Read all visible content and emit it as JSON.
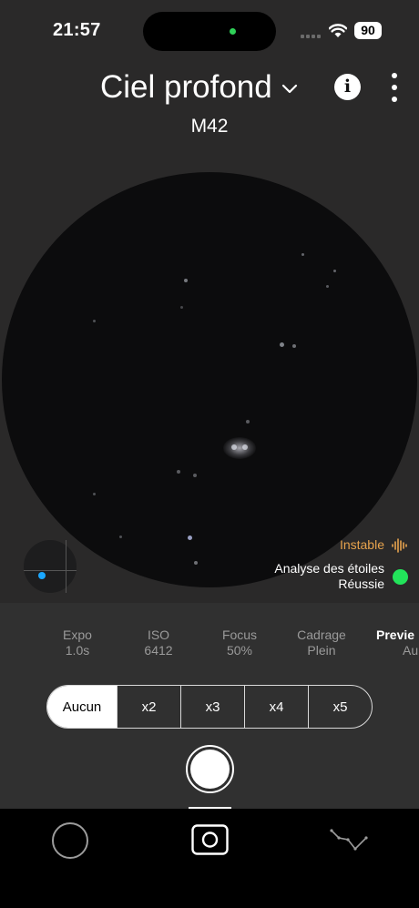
{
  "status_bar": {
    "time": "21:57",
    "battery": "90"
  },
  "header": {
    "mode_title": "Ciel profond",
    "target": "M42",
    "icons": {
      "mode_dropdown": "chevron-down-icon",
      "info": "info-icon",
      "more": "more-vertical-icon"
    },
    "info_glyph": "i"
  },
  "viewer": {
    "stability_label": "Instable",
    "analysis_title": "Analyse des étoiles",
    "analysis_status": "Réussie",
    "colors": {
      "stability": "#e7a34d",
      "analysis_ok": "#22e35a",
      "minimap_marker": "#1aa7ff"
    }
  },
  "params": [
    {
      "label": "Expo",
      "value": "1.0s"
    },
    {
      "label": "ISO",
      "value": "6412"
    },
    {
      "label": "Focus",
      "value": "50%"
    },
    {
      "label": "Cadrage",
      "value": "Plein"
    },
    {
      "label": "Previe",
      "value": "Au"
    }
  ],
  "zoom_options": [
    "Aucun",
    "x2",
    "x3",
    "x4",
    "x5"
  ],
  "selected_zoom": "Aucun",
  "tabbar": {
    "items": [
      "circle-tab-icon",
      "camera-tab-icon",
      "constellation-tab-icon"
    ],
    "active": "camera-tab-icon"
  }
}
